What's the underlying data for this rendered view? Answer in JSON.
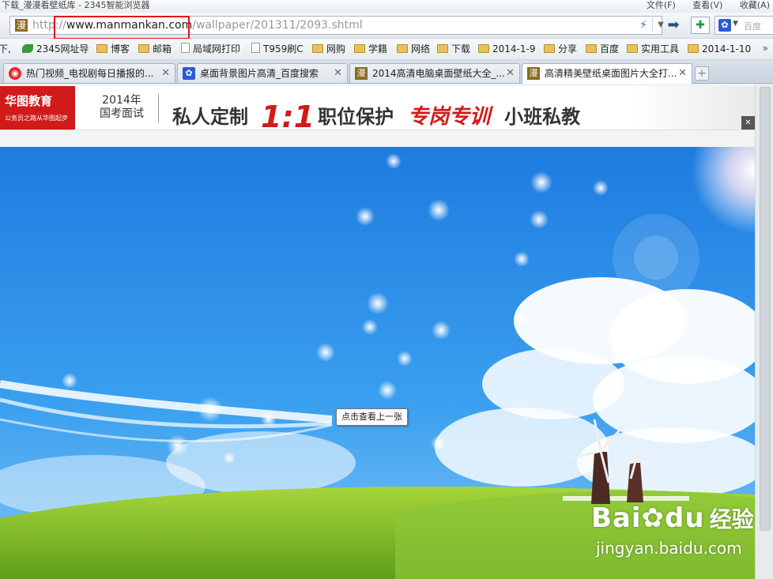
{
  "window": {
    "title": "下载_漫漫看壁纸库 - 2345智能浏览器",
    "menus": [
      "文件(F)",
      "查看(V)",
      "收藏(A)"
    ]
  },
  "address": {
    "scheme": "http://",
    "host": "www.manmankan.com",
    "path": "/wallpaper/201311/2093.shtml",
    "site_badge": "漫"
  },
  "search": {
    "placeholder": "百度"
  },
  "favorites": [
    {
      "label": "下,",
      "icon": "none"
    },
    {
      "label": "2345网址导",
      "icon": "2345-icon"
    },
    {
      "label": "博客",
      "icon": "folder-icon"
    },
    {
      "label": "邮箱",
      "icon": "folder-icon"
    },
    {
      "label": "局域网打印",
      "icon": "page-icon"
    },
    {
      "label": "T959刷C",
      "icon": "page-icon"
    },
    {
      "label": "网购",
      "icon": "folder-icon"
    },
    {
      "label": "学籍",
      "icon": "folder-icon"
    },
    {
      "label": "网络",
      "icon": "folder-icon"
    },
    {
      "label": "下载",
      "icon": "folder-icon"
    },
    {
      "label": "2014-1-9",
      "icon": "folder-icon"
    },
    {
      "label": "分享",
      "icon": "folder-icon"
    },
    {
      "label": "百度",
      "icon": "folder-icon"
    },
    {
      "label": "实用工具",
      "icon": "folder-icon"
    },
    {
      "label": "2014-1-10",
      "icon": "folder-icon"
    }
  ],
  "favorites_more": "»",
  "tabs": [
    {
      "label": "热门视频_电视剧每日播报的...",
      "icon": "weibo-icon",
      "active": false
    },
    {
      "label": "桌面背景图片高清_百度搜索",
      "icon": "baidu-paw-icon",
      "active": false
    },
    {
      "label": "2014高清电脑桌面壁纸大全_...",
      "icon": "manmankan-icon",
      "active": false
    },
    {
      "label": "高清精美壁纸桌面图片大全打...",
      "icon": "manmankan-icon",
      "active": true
    }
  ],
  "ad": {
    "logo_name": "华图教育",
    "logo_slogan": "公务员之路从华图起步",
    "year_line1": "2014年",
    "year_line2": "国考面试",
    "slogan_a": "私人定制",
    "slogan_b": "1:1",
    "slogan_c": "职位保护",
    "slogan_d": "专岗专训",
    "slogan_e": "小班私教"
  },
  "tooltip": "点击查看上一张",
  "watermark": {
    "brand": "Bai",
    "brand2": "du",
    "cn": "经验",
    "domain": "jingyan.baidu.com"
  },
  "colors": {
    "accent_red": "#d11a1a",
    "sky_top": "#1f7be0",
    "sky_bottom": "#7fc4f5",
    "grass": "#7dbb2c"
  }
}
